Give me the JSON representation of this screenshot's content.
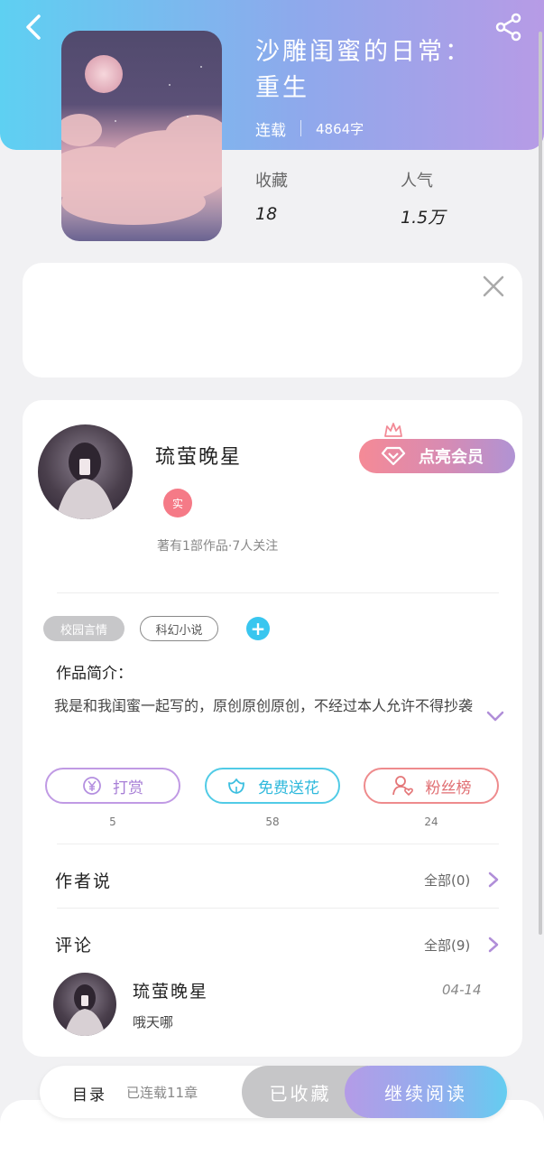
{
  "book": {
    "title": "沙雕闺蜜的日常：重生",
    "status": "连载",
    "word_count": "4864字",
    "stats": [
      {
        "label": "收藏",
        "value": "18"
      },
      {
        "label": "人气",
        "value": "1.5万"
      }
    ]
  },
  "author": {
    "name": "琉萤晚星",
    "verified_badge": "实",
    "meta": "著有1部作品·7人关注",
    "vip_button": "点亮会员"
  },
  "tags": [
    "校园言情",
    "科幻小说"
  ],
  "intro": {
    "label": "作品简介：",
    "text": "我是和我闺蜜一起写的，原创原创原创，不经过本人允许不得抄袭"
  },
  "actions": [
    {
      "label": "打赏",
      "count": "5",
      "icon": "yen-icon"
    },
    {
      "label": "免费送花",
      "count": "58",
      "icon": "flower-icon"
    },
    {
      "label": "粉丝榜",
      "count": "24",
      "icon": "fans-icon"
    }
  ],
  "author_says": {
    "label": "作者说",
    "all": "全部(0)"
  },
  "comments": {
    "label": "评论",
    "all": "全部(9)",
    "items": [
      {
        "name": "琉萤晚星",
        "date": "04-14",
        "text": "哦天哪"
      }
    ]
  },
  "bottom": {
    "toc": "目录",
    "chapters": "已连载11章",
    "collected": "已收藏",
    "continue": "继续阅读"
  },
  "colors": {
    "header_gradient": [
      "#5ed0f2",
      "#b79be6"
    ],
    "tip": "#a77ed6",
    "flower": "#2fb9dc",
    "fans": "#e06e72",
    "vip": "#f58a96"
  }
}
